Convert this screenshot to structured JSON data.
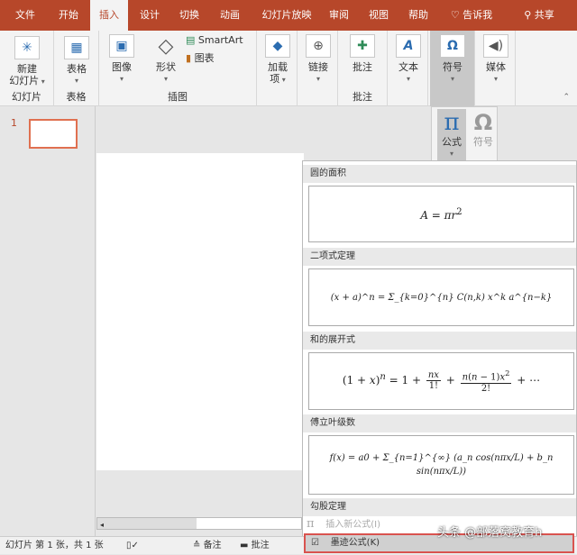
{
  "tabs": [
    "文件",
    "开始",
    "插入",
    "设计",
    "切换",
    "动画",
    "幻灯片放映",
    "审阅",
    "视图",
    "帮助",
    "告诉我",
    "共享"
  ],
  "active_tab": "插入",
  "ribbon": {
    "new_slide": "新建\n幻灯片",
    "new_slide_a": "新建",
    "new_slide_b": "幻灯片",
    "group_slides": "幻灯片",
    "table": "表格",
    "group_table": "表格",
    "image": "图像",
    "shapes": "形状",
    "smartart": "SmartArt",
    "chart": "图表",
    "group_illustrations": "插图",
    "addins_a": "加载",
    "addins_b": "项",
    "link": "链接",
    "comment": "批注",
    "group_comments": "批注",
    "text": "文本",
    "symbols": "符号",
    "media": "媒体"
  },
  "symbols_menu": {
    "equation": "公式",
    "symbol": "符号"
  },
  "slide_panel": {
    "slide_number": "1"
  },
  "gallery": {
    "sections": [
      {
        "title": "圆的面积",
        "equation": "A = πr²"
      },
      {
        "title": "二项式定理",
        "equation": "(x + a)^n = Σ_{k=0}^{n} C(n,k) x^k a^{n−k}"
      },
      {
        "title": "和的展开式",
        "equation": "(1 + x)^n = 1 + nx/1! + n(n−1)x²/2! + ⋯"
      },
      {
        "title": "傅立叶级数",
        "equation": "f(x) = a0 + Σ_{n=1}^{∞} (a_n cos(nπx/L) + b_n sin(nπx/L))"
      },
      {
        "title": "勾股定理"
      }
    ],
    "insert_new": "插入新公式(I)",
    "ink_equation": "墨迹公式(K)"
  },
  "status": {
    "slide_info": "幻灯片 第 1 张，共 1 张",
    "notes": "备注",
    "comments": "批注"
  },
  "watermark": "头条 @部落窝教育h",
  "colors": {
    "accent": "#b7472a",
    "highlight": "#d9534f"
  }
}
